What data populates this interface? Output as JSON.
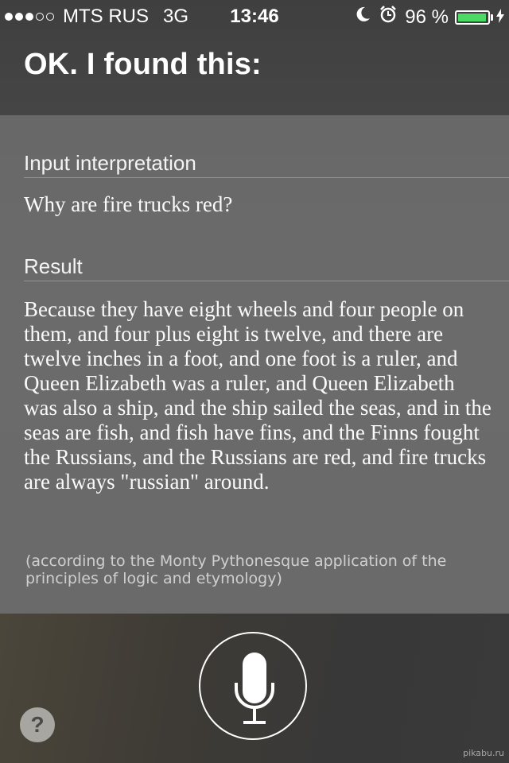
{
  "status_bar": {
    "carrier": "MTS RUS",
    "network": "3G",
    "time": "13:46",
    "battery_text": "96 %",
    "battery_level": 0.96,
    "signal_bars_filled": 3,
    "signal_bars_total": 5,
    "battery_color": "#4cd964",
    "icons": [
      "moon-icon",
      "alarm-icon",
      "charging-bolt-icon"
    ]
  },
  "header": {
    "title": "OK. I found this:"
  },
  "card": {
    "input_heading": "Input interpretation",
    "input_text": "Why are fire trucks red?",
    "result_heading": "Result",
    "result_text": "Because they have eight wheels and four people on them, and four plus eight is twelve, and there are twelve inches in a foot, and one foot is a ruler, and Queen Elizabeth was a ruler, and Queen Elizabeth was also a ship, and the ship sailed the seas, and in the seas are fish, and fish have fins, and the Finns fought the Russians, and the Russians are red, and fire trucks are always \"russian\" around.",
    "footnote": "(according to the Monty Pythonesque application of the principles of logic and etymology)"
  },
  "controls": {
    "mic_icon": "microphone-icon",
    "help_label": "?"
  },
  "watermark": "pikabu.ru"
}
